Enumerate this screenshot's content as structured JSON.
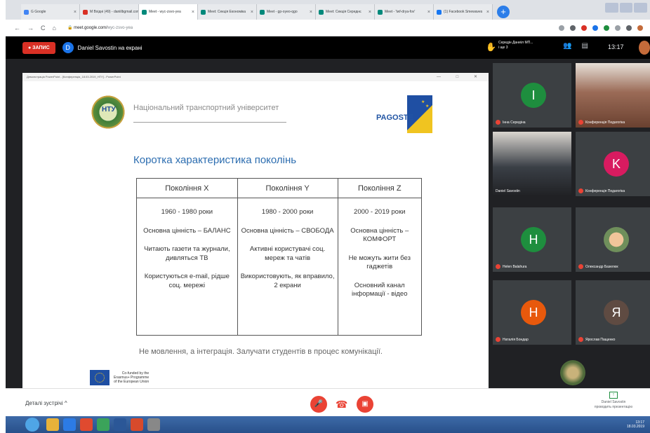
{
  "browser": {
    "tabs": [
      {
        "label": "G Google",
        "color": "#4285f4"
      },
      {
        "label": "M Вхідні (49) - daniilbgmail.com",
        "color": "#d93025"
      },
      {
        "label": "Meet - wyc-zsvo-yea",
        "color": "#00897b"
      },
      {
        "label": "Meet: Секція Економіка",
        "color": "#00897b"
      },
      {
        "label": "Meet - gp-oyeo-qgo",
        "color": "#00897b"
      },
      {
        "label": "Meet: Секція Середнє",
        "color": "#00897b"
      },
      {
        "label": "Meet - 'lwf-drya-fov'",
        "color": "#00897b"
      },
      {
        "label": "(1) Facebook Smewaves",
        "color": "#1877f2"
      }
    ],
    "new_tab": "+",
    "nav": {
      "back": "←",
      "forward": "→",
      "reload": "C",
      "home": "⌂"
    },
    "url": "meet.google.com/",
    "url_rest": "wyc-zsvo-yea"
  },
  "meet": {
    "record_label": "● ЗАПИС",
    "presenter_initial": "D",
    "presenting_text": "Daniel Savostin на екрані",
    "participant_info_line1": "Середін Даниїл МП...",
    "participant_info_line2": "і ще 3",
    "participants_icon": "👥",
    "chat_icon": "▤",
    "clock": "13:17"
  },
  "presentation": {
    "window_title": "Демонстрація PowerPoint - [Конференція_18.03.2019_НТУ] - PowerPoint",
    "window_controls": "— □ ✕",
    "logo_text": "НТУ",
    "university": "Національний транспортний університет",
    "pagoste": "PAGOSTE",
    "heading": "Коротка характеристика поколінь",
    "columns": [
      "Покоління X",
      "Покоління Y",
      "Покоління Z"
    ],
    "cells": [
      [
        "1960 - 1980 роки",
        "Основна цінність – БАЛАНС",
        "Читають газети та журнали, дивляться ТВ",
        "Користуються e-mail, рідше соц. мережі"
      ],
      [
        "1980 - 2000 роки",
        "Основна цінність – СВОБОДА",
        "Активні користувачі соц. мереж та чатів",
        "Використовують, як вправило, 2 екрани"
      ],
      [
        "2000 - 2019 роки",
        "Основна цінність – КОМФОРТ",
        "Не можуть жити без гаджетів",
        "Основний канал інформації - відео"
      ]
    ],
    "note": "Не мовлення, а інтеграція. Залучати студентів в процес комунікації.",
    "erasmus_lines": [
      "Co-funded by the",
      "Erasmus+ Programme",
      "of the European Union"
    ]
  },
  "participants": [
    {
      "name": "Інна Середіна",
      "initial": "І",
      "color": "#1e8e3e"
    },
    {
      "name": "Конференція Педагогіка",
      "initial": "",
      "color": ""
    },
    {
      "name": "Daniel Savostin",
      "initial": "",
      "color": ""
    },
    {
      "name": "Конференція Педагогіка",
      "initial": "K",
      "color": "#d81b60"
    },
    {
      "name": "Helen Balahura",
      "initial": "H",
      "color": "#1e8e3e"
    },
    {
      "name": "Олександр Базелюк",
      "initial": "",
      "color": ""
    },
    {
      "name": "Наталія Бондар",
      "initial": "H",
      "color": "#e8590c"
    },
    {
      "name": "Ярослав Пащенко",
      "initial": "Я",
      "color": "#5f4b42"
    }
  ],
  "bottom": {
    "details": "Деталі зустрічі  ^",
    "mic_icon": "🎤",
    "hangup_icon": "☎",
    "cam_icon": "▣",
    "presenting_line1": "Daniel Savostin",
    "presenting_line2": "проводить презентацію"
  },
  "taskbar": {
    "tray_time": "13:17",
    "tray_date": "18.03.2019",
    "apps": [
      "#e8b23a",
      "#2c7be5",
      "#e04a2f",
      "#3ba35a",
      "#2b5797",
      "#d74a2c",
      "#888888"
    ]
  }
}
